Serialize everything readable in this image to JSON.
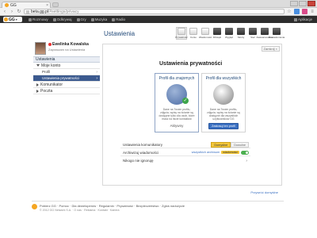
{
  "browser": {
    "tab_title": "GG",
    "tab_close": "×",
    "url_host": "beta.gg.pl",
    "url_path": "/#settings/privacy"
  },
  "ggbar": {
    "logo": "GG",
    "nav": [
      {
        "label": "Rozmowy",
        "icon": "chat-icon"
      },
      {
        "label": "Odkrywaj",
        "icon": "compass-icon"
      },
      {
        "label": "Gry",
        "icon": "game-icon"
      },
      {
        "label": "Muzyka",
        "icon": "music-icon"
      },
      {
        "label": "Radio",
        "icon": "radio-icon"
      }
    ],
    "apps_label": "Aplikacje"
  },
  "profile": {
    "name": "Ewelinka Kowalska",
    "status": "Zapraszam na Ustawienia"
  },
  "sidebar": {
    "header": "Ustawienia",
    "items": [
      {
        "label": "Moje konto",
        "expanded": true
      },
      {
        "label": "Profil",
        "sub": true
      },
      {
        "label": "Ustawienia prywatności",
        "sub": true,
        "active": true
      },
      {
        "label": "Komunikator",
        "expanded": false
      },
      {
        "label": "Poczta",
        "expanded": false
      }
    ]
  },
  "content": {
    "title": "Ustawienia",
    "icons": [
      {
        "label": "Prywatność",
        "icon": "privacy-icon",
        "selected": true
      },
      {
        "label": "Konto",
        "icon": "account-icon"
      },
      {
        "label": "Wiadomości",
        "icon": "messages-icon"
      },
      {
        "label": "Dźwięki",
        "icon": "sounds-icon"
      },
      {
        "label": "Wygląd",
        "icon": "appearance-icon"
      },
      {
        "label": "Skróty",
        "icon": "shortcuts-icon"
      },
      {
        "label": "Sieć",
        "icon": "network-icon"
      },
      {
        "label": "Zaawansowane",
        "icon": "advanced-icon"
      },
      {
        "label": "Powiadomienia",
        "icon": "notify-icon"
      }
    ],
    "panel_tool": "Zamknij ×",
    "privacy_title": "Ustawienia prywatności",
    "cards": {
      "friends": {
        "title": "Profil dla znajomych",
        "desc": "Dane na Twoim profilu, zdjęcia, wpisy na ścianie są dostępne tylko dla osób, które masz na liście kontaktów",
        "state": "Aktywny"
      },
      "everyone": {
        "title": "Profil dla wszystkich",
        "desc": "Dane na Twoim profilu, zdjęcia, wpisy na ścianie są dostępne dla wszystkich użytkowników GG",
        "button": "Zastosuj ten profil"
      }
    },
    "rows": {
      "communicator": {
        "label": "Ustawienia komunikatory",
        "options": [
          "Domyślne",
          "Dowolne"
        ]
      },
      "archive": {
        "label": "Archiwizuj wiadomości",
        "link": "wszystkich archiwum",
        "chip": "wiadomości"
      },
      "ignore": {
        "label": "Nikogo nie ignoruję"
      }
    },
    "policy_link": "Przywróć domyślne"
  },
  "footer": {
    "links": "Pobierz GG · Pomoc · Dla deweloperów · Regulamin · Prywatność · Bezpieczeństwo · Zgłoś nadużycie",
    "copy": "© 2012 GG Network S.A. · O nas · Reklama · Kontakt · Kariera"
  }
}
